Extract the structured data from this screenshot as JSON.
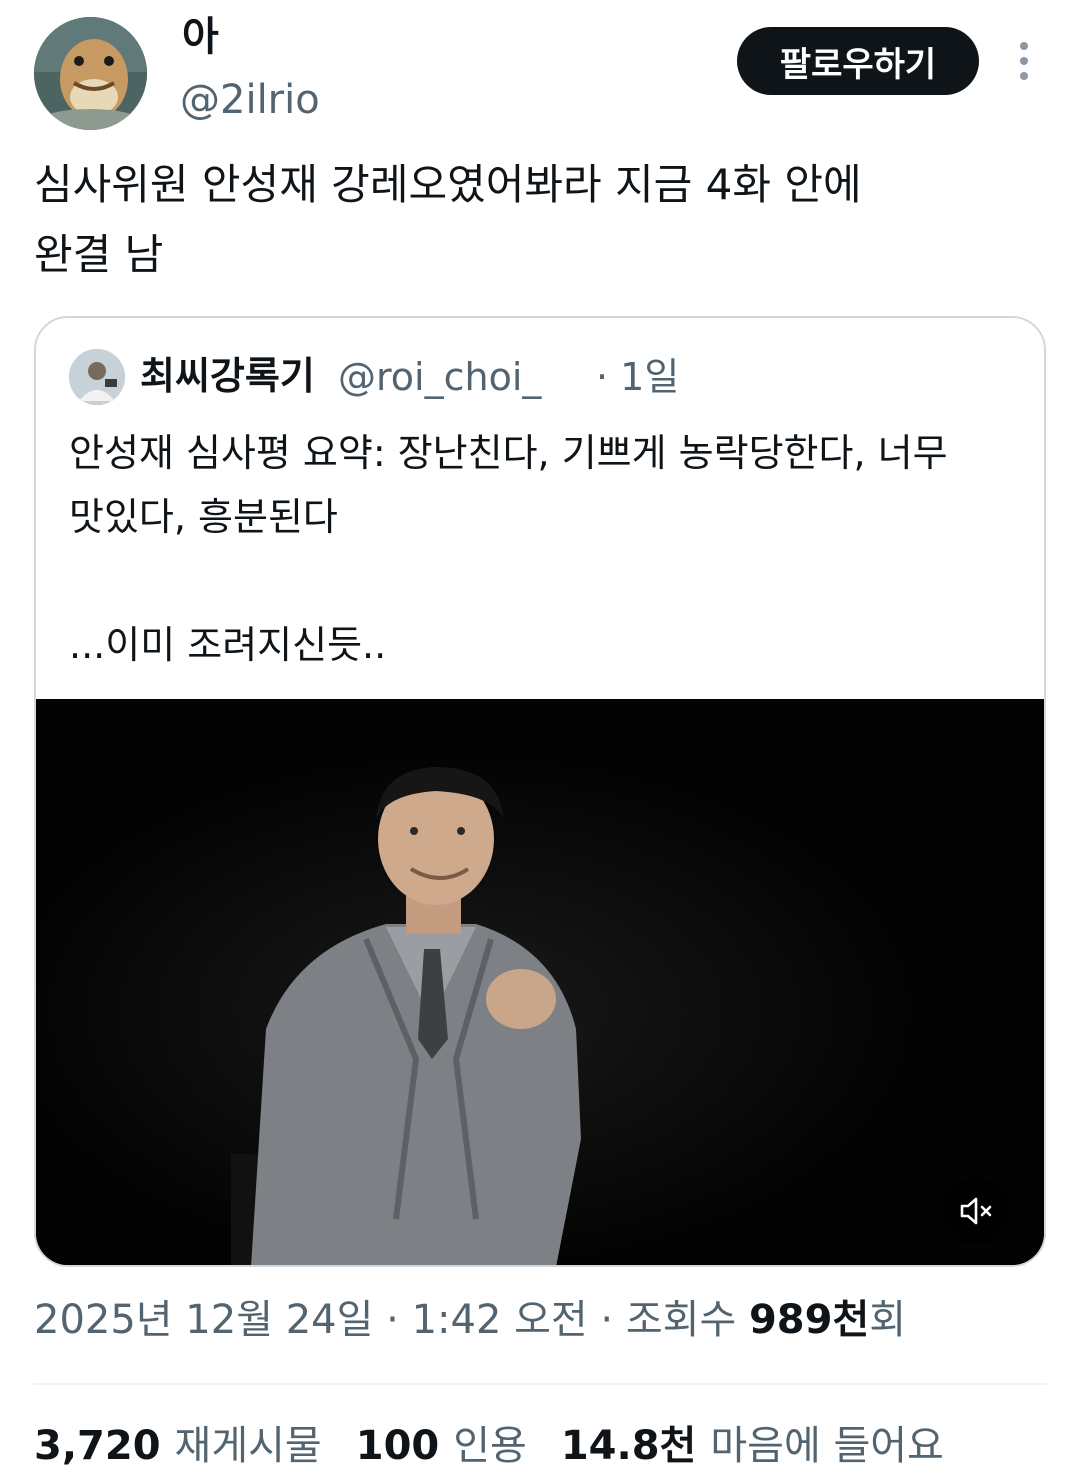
{
  "author": {
    "display_name": "아",
    "handle": "@2ilrio",
    "follow_label": "팔로우하기"
  },
  "tweet": {
    "text": "심사위원 안성재 강레오였어봐라 지금 4화 안에\n완결 남"
  },
  "quote": {
    "display_name": "최씨강록기",
    "handle": "@roi_choi_",
    "time": "· 1일",
    "text": "안성재 심사평 요약: 장난친다, 기쁘게 농락당한다, 너무\n맛있다, 흥분된다\n\n...이미 조려지신듯.."
  },
  "meta": {
    "date": "2025년 12월 24일 · 1:42 오전 · 조회수 ",
    "views_num": "989천",
    "views_suffix": "회"
  },
  "stats": {
    "retweets_num": "3,720",
    "retweets_label": "재게시물",
    "quotes_num": "100",
    "quotes_label": "인용",
    "likes_num": "14.8천",
    "likes_label": "마음에 들어요"
  },
  "colors": {
    "text": "#0f1419",
    "secondary": "#536471",
    "border": "#cfd9de",
    "button_bg": "#0f1419"
  },
  "icons": {
    "more": "more-vertical-icon",
    "mute": "volume-muted-icon"
  }
}
